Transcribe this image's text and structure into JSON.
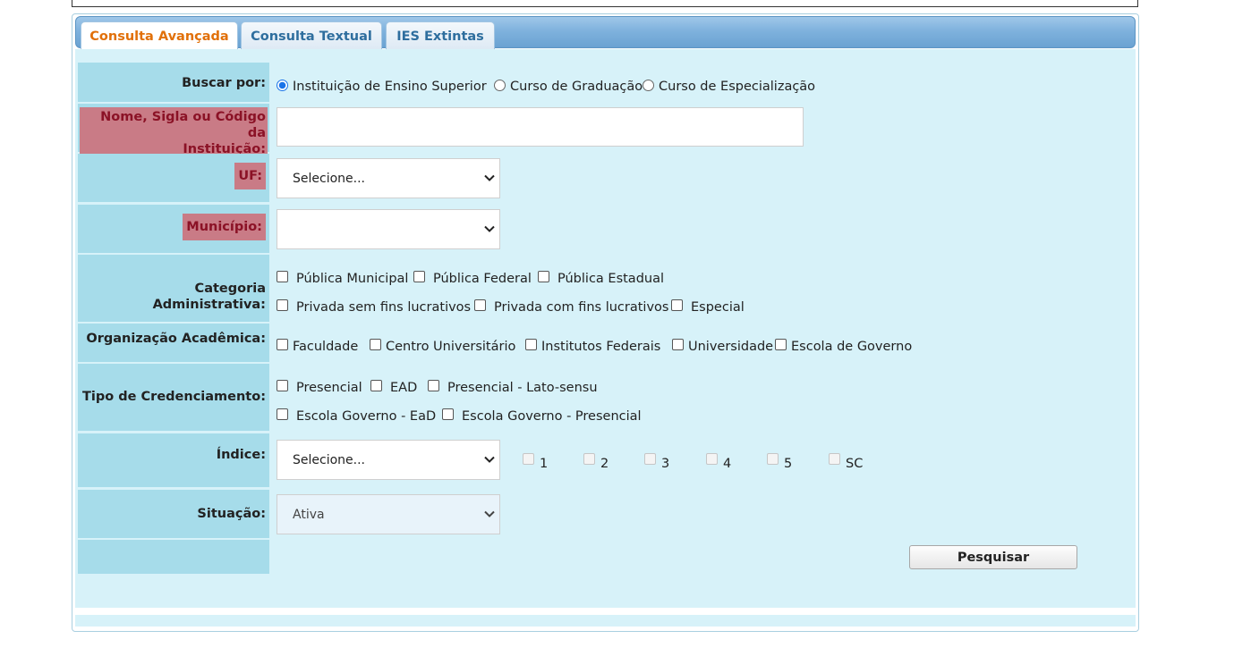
{
  "tabs": [
    {
      "label": "Consulta Avançada",
      "active": true
    },
    {
      "label": "Consulta Textual",
      "active": false
    },
    {
      "label": "IES Extintas",
      "active": false
    }
  ],
  "buscar": {
    "label": "Buscar por:",
    "options": [
      "Instituição de Ensino Superior",
      "Curso de Graduação",
      "Curso de Especialização"
    ],
    "selected": "Instituição de Ensino Superior"
  },
  "nome": {
    "label_line1": "Nome, Sigla ou Código da",
    "label_line2": "Instituição:",
    "value": ""
  },
  "uf": {
    "label": "UF:",
    "value": "Selecione..."
  },
  "municipio": {
    "label": "Município:",
    "value": ""
  },
  "categoria": {
    "label": "Categoria Administrativa:",
    "options": [
      "Pública Municipal",
      "Pública Federal",
      "Pública Estadual",
      "Privada sem fins lucrativos",
      "Privada com fins lucrativos",
      "Especial"
    ]
  },
  "organizacao": {
    "label": "Organização Acadêmica:",
    "options": [
      "Faculdade",
      "Centro Universitário",
      "Institutos Federais",
      "Universidade",
      "Escola de Governo"
    ]
  },
  "credenciamento": {
    "label": "Tipo de Credenciamento:",
    "options": [
      "Presencial",
      "EAD",
      "Presencial - Lato-sensu",
      "Escola Governo - EaD",
      "Escola Governo - Presencial"
    ]
  },
  "indice": {
    "label": "Índice:",
    "value": "Selecione...",
    "options": [
      "1",
      "2",
      "3",
      "4",
      "5",
      "SC"
    ]
  },
  "situacao": {
    "label": "Situação:",
    "value": "Ativa"
  },
  "search_button": "Pesquisar",
  "colors": {
    "content_bg": "#d7f2f9",
    "label_bg": "#a6dcea",
    "required_highlight": "#c97b86",
    "active_tab_text": "#e17009",
    "tab_text": "#2e6e9e"
  }
}
